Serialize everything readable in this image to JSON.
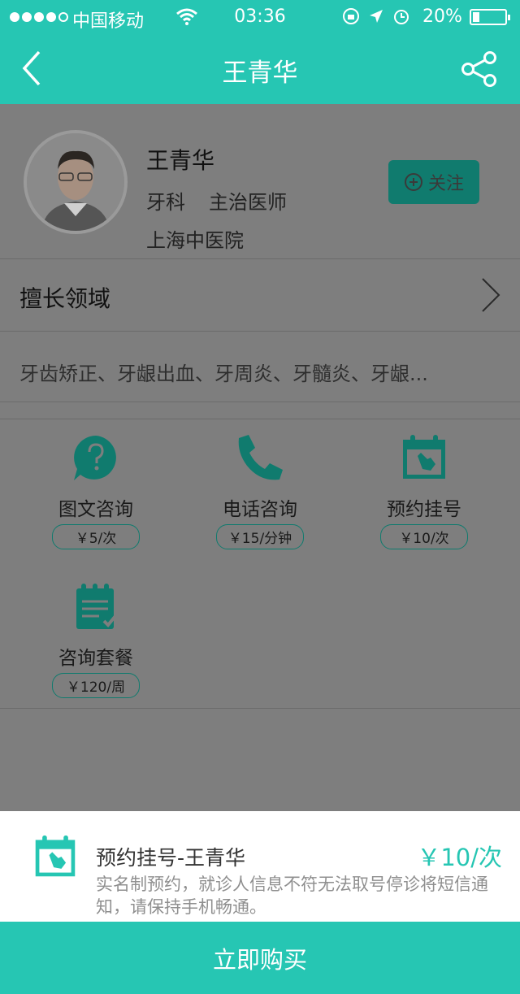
{
  "status_bar": {
    "carrier": "中国移动",
    "time": "03:36",
    "battery": "20%"
  },
  "nav": {
    "title": "王青华"
  },
  "doctor": {
    "name": "王青华",
    "department": "牙科",
    "title": "主治医师",
    "hospital": "上海中医院",
    "follow_label": "关注"
  },
  "expertise": {
    "label": "擅长领域",
    "text": "牙齿矫正、牙龈出血、牙周炎、牙髓炎、牙龈..."
  },
  "services": [
    {
      "label": "图文咨询",
      "price": "￥5/次",
      "icon": "chat-question-icon"
    },
    {
      "label": "电话咨询",
      "price": "￥15/分钟",
      "icon": "phone-icon"
    },
    {
      "label": "预约挂号",
      "price": "￥10/次",
      "icon": "calendar-hand-icon"
    },
    {
      "label": "咨询套餐",
      "price": "￥120/周",
      "icon": "clipboard-check-icon"
    }
  ],
  "sheet": {
    "title": "预约挂号-王青华",
    "price": "￥10/次",
    "note": "实名制预约，就诊人信息不符无法取号停诊将短信通知，请保持手机畅通。"
  },
  "buy_button": "立即购买",
  "colors": {
    "accent": "#26c6b3",
    "accent_dark": "#107b6e"
  }
}
